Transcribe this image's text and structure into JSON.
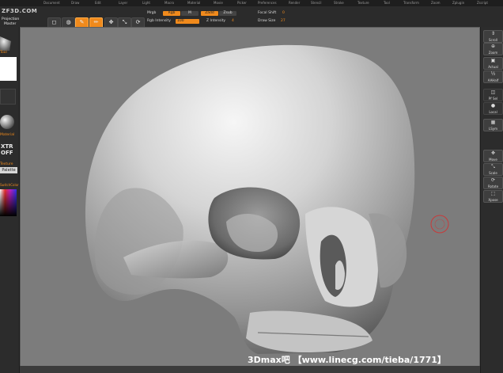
{
  "app": {
    "logo": "ZBRUSH",
    "version_text": "ZF3D.COM"
  },
  "menu": [
    "Document",
    "Draw",
    "Edit",
    "Layer",
    "Light",
    "Macro",
    "Material",
    "Movie",
    "Picker",
    "Preferences",
    "Render",
    "Stencil",
    "Stroke",
    "Texture",
    "Tool",
    "Transform",
    "Zoom",
    "Zplugin",
    "Zscript"
  ],
  "toolbar": {
    "projection_label": "Projection",
    "projection_sub": "Master",
    "buttons": [
      {
        "name": "frame",
        "glyph": "◻",
        "label": "Frame",
        "active": false
      },
      {
        "name": "lightbox",
        "glyph": "◍",
        "label": "Lbox",
        "active": false
      },
      {
        "name": "edit",
        "glyph": "✎",
        "label": "Edit",
        "active": true
      },
      {
        "name": "draw",
        "glyph": "✏",
        "label": "Draw",
        "active": true
      },
      {
        "name": "move",
        "glyph": "✥",
        "label": "Move",
        "active": false
      },
      {
        "name": "scale",
        "glyph": "⤡",
        "label": "Scale",
        "active": false
      },
      {
        "name": "rotate",
        "glyph": "⟳",
        "label": "Rotate",
        "active": false
      }
    ],
    "mrgb": "Mrgb",
    "rgb": "Rgb",
    "m": "M",
    "zadd": "Zadd",
    "zsub": "Zsub",
    "rgb_intensity_label": "Rgb Intensity",
    "rgb_intensity_value": "100",
    "z_intensity_label": "Z Intensity",
    "z_intensity_value": "4",
    "focal_shift_label": "Focal Shift",
    "focal_shift_value": "0",
    "draw_size_label": "Draw Size",
    "draw_size_value": "27"
  },
  "left_panel": {
    "tool_label": "Tool",
    "material_label": "Material",
    "texture_toggle": "XTR",
    "texture_state": "OFF",
    "texture_label": "Texture",
    "palette_button": "Palette",
    "switch_color": "SwitchColor"
  },
  "right_panel": [
    {
      "glyph": "⇕",
      "label": "Scroll"
    },
    {
      "glyph": "⊕",
      "label": "Zoom"
    },
    {
      "glyph": "▣",
      "label": "Actual"
    },
    {
      "glyph": "½",
      "label": "AAHalf"
    },
    {
      "glyph": "◫",
      "label": "Pf Sel"
    },
    {
      "glyph": "●",
      "label": "Local"
    },
    {
      "glyph": "▦",
      "label": "LSym"
    },
    {
      "glyph": "✥",
      "label": "Move"
    },
    {
      "glyph": "⤡",
      "label": "Scale"
    },
    {
      "glyph": "⟳",
      "label": "Rotate"
    },
    {
      "glyph": "⬚",
      "label": "Xpose"
    }
  ],
  "watermark": "3Dmax吧 【www.linecg.com/tieba/1771】",
  "colors": {
    "accent": "#f08a1c",
    "canvas": "#7c7c7c",
    "panel": "#2c2c2c",
    "brush_cursor": "#c83a3a"
  }
}
